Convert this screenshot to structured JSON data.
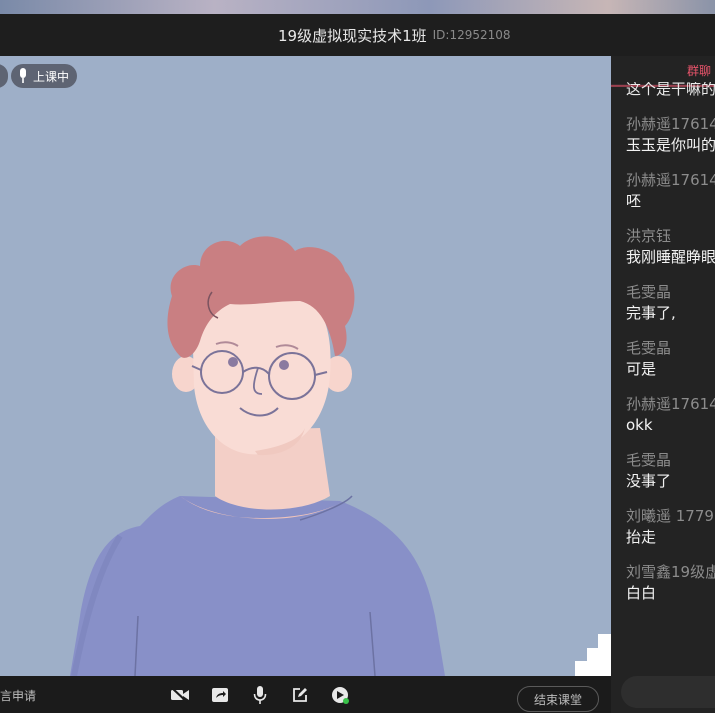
{
  "header": {
    "class_title": "19级虚拟现实技术1班",
    "class_id": "ID:12952108"
  },
  "stage": {
    "live_label": "上课中"
  },
  "toolbar": {
    "apply_label": "发言申请",
    "end_class_label": "结束课堂",
    "icons": [
      "camera-off-icon",
      "screen-share-icon",
      "microphone-icon",
      "whiteboard-edit-icon",
      "record-icon"
    ]
  },
  "chat": {
    "tab_label": "群聊",
    "cut_message": "这个是干嘛的",
    "messages": [
      {
        "name": "孙赫遥17614",
        "text": "玉玉是你叫的"
      },
      {
        "name": "孙赫遥17614",
        "text": "呸"
      },
      {
        "name": "洪京钰",
        "text": "我刚睡醒睁眼"
      },
      {
        "name": "毛雯晶",
        "text": "完事了,"
      },
      {
        "name": "毛雯晶",
        "text": "可是"
      },
      {
        "name": "孙赫遥17614",
        "text": "okk"
      },
      {
        "name": "毛雯晶",
        "text": "没事了"
      },
      {
        "name": "刘曦遥 1779",
        "text": "抬走"
      },
      {
        "name": "刘雪鑫19级虚",
        "text": "白白"
      }
    ]
  },
  "colors": {
    "stage_bg": "#9eafc8",
    "accent": "#e9546b",
    "panel_bg": "#232323"
  }
}
